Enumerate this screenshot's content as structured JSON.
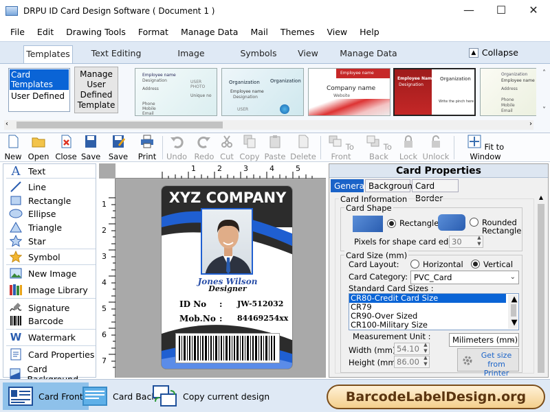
{
  "window": {
    "title": "DRPU ID Card Design Software ( Document 1 )",
    "minimize": "—",
    "maximize": "☐",
    "close": "✕"
  },
  "menu": [
    "File",
    "Edit",
    "Drawing Tools",
    "Format",
    "Manage Data",
    "Mail",
    "Themes",
    "View",
    "Help"
  ],
  "ribbon_tabs": [
    "Templates",
    "Text Editing",
    "Image Editing",
    "Symbols",
    "View",
    "Manage Data"
  ],
  "ribbon_active_tab": "Templates",
  "collapse_label": "Collapse",
  "template_list": [
    "Card Templates",
    "User Defined"
  ],
  "template_list_selected": "Card Templates",
  "manage_button": "Manage User Defined Template",
  "thumb_texts": {
    "t1_name": "Employee name",
    "t1_desig": "Designation",
    "t1_addr": "Address",
    "t1_photo": "USER PHOTO",
    "t1_unique": "Unique no",
    "t1_phone": "Phone",
    "t1_mobile": "Mobile",
    "t1_email": "Email",
    "t2_org": "Organization",
    "t2_name": "Employee name",
    "t2_desig": "Designation",
    "t2_photo": "USER",
    "t2_org2": "Organization",
    "t3_name": "Employee name",
    "t3_company": "Company name",
    "t3_website": "Website",
    "t4_name": "Employee Name",
    "t4_desig": "Designation",
    "t4_org": "Organization",
    "t4_sign": "Write the pinch here",
    "t5_org": "Organization",
    "t5_name": "Employee name",
    "t5_addr": "Address",
    "t5_phone": "Phone",
    "t5_mobile": "Mobile",
    "t5_email": "Email"
  },
  "toolbar": [
    {
      "label": "New",
      "icon": "new-file-icon",
      "enabled": true
    },
    {
      "label": "Open",
      "icon": "open-folder-icon",
      "enabled": true
    },
    {
      "label": "Close",
      "icon": "close-file-icon",
      "enabled": true
    },
    {
      "label": "Save",
      "icon": "save-icon",
      "enabled": true
    },
    {
      "label": "Save as",
      "icon": "save-as-icon",
      "enabled": true
    },
    {
      "label": "Print",
      "icon": "print-icon",
      "enabled": true
    },
    {
      "label": "Undo",
      "icon": "undo-icon",
      "enabled": false
    },
    {
      "label": "Redo",
      "icon": "redo-icon",
      "enabled": false
    },
    {
      "label": "Cut",
      "icon": "cut-icon",
      "enabled": false
    },
    {
      "label": "Copy",
      "icon": "copy-icon",
      "enabled": false
    },
    {
      "label": "Paste",
      "icon": "paste-icon",
      "enabled": false
    },
    {
      "label": "Delete",
      "icon": "delete-icon",
      "enabled": false
    },
    {
      "label": "To Front",
      "icon": "to-front-icon",
      "enabled": false
    },
    {
      "label": "To Back",
      "icon": "to-back-icon",
      "enabled": false
    },
    {
      "label": "Lock",
      "icon": "lock-icon",
      "enabled": false
    },
    {
      "label": "Unlock",
      "icon": "unlock-icon",
      "enabled": false
    },
    {
      "label": "Fit to Window",
      "icon": "fit-window-icon",
      "enabled": true
    }
  ],
  "tools": [
    "Text",
    "Line",
    "Rectangle",
    "Ellipse",
    "Triangle",
    "Star",
    "Symbol",
    "New Image",
    "Image Library",
    "Signature",
    "Barcode",
    "Watermark",
    "Card Properties",
    "Card Background"
  ],
  "ruler": {
    "top": [
      "1",
      "2",
      "3",
      "4",
      "5"
    ],
    "left": [
      "1",
      "2",
      "3",
      "4",
      "5",
      "6",
      "7"
    ]
  },
  "card": {
    "company": "XYZ COMPANY",
    "name": "Jones Wilson",
    "title": "Designer",
    "id_label": "ID No",
    "id_sep": ":",
    "id_value": "JW-512032",
    "mob_label": "Mob.No",
    "mob_sep": ":",
    "mob_value": "84469254xx",
    "colors": {
      "dark": "#2c2c2c",
      "blue": "#1f5fd1",
      "name": "#2a4fa8"
    }
  },
  "props": {
    "heading": "Card Properties",
    "tabs": [
      "General",
      "Background",
      "Card Border"
    ],
    "active_tab": "General",
    "card_info": "Card Information",
    "card_shape": "Card Shape",
    "rect_label": "Rectangle",
    "rounded_label_1": "Rounded",
    "rounded_label_2": "Rectangle",
    "shape_selected": "Rectangle",
    "pixels_label": "Pixels for shape card edge :",
    "pixels_value": "30",
    "card_size": "Card Size (mm)",
    "layout_label": "Card Layout:",
    "layout_h": "Horizontal",
    "layout_v": "Vertical",
    "layout_selected": "Vertical",
    "category_label": "Card Category:",
    "category_value": "PVC_Card",
    "std_sizes_label": "Standard Card Sizes :",
    "std_sizes": [
      "CR80-Credit Card Size",
      "CR79",
      "CR90-Over Sized",
      "CR100-Military Size"
    ],
    "std_selected": "CR80-Credit Card Size",
    "measure_label": "Measurement Unit :",
    "measure_value": "Milimeters (mm)",
    "width_label": "Width  (mm)",
    "width_value": "54.10",
    "height_label": "Height  (mm)",
    "height_value": "86.00",
    "getsize_1": "Get size",
    "getsize_2": "from Printer"
  },
  "bottom": {
    "front": "Card Front",
    "back": "Card Back",
    "copy": "Copy current design",
    "brand": "BarcodeLabelDesign.org"
  }
}
